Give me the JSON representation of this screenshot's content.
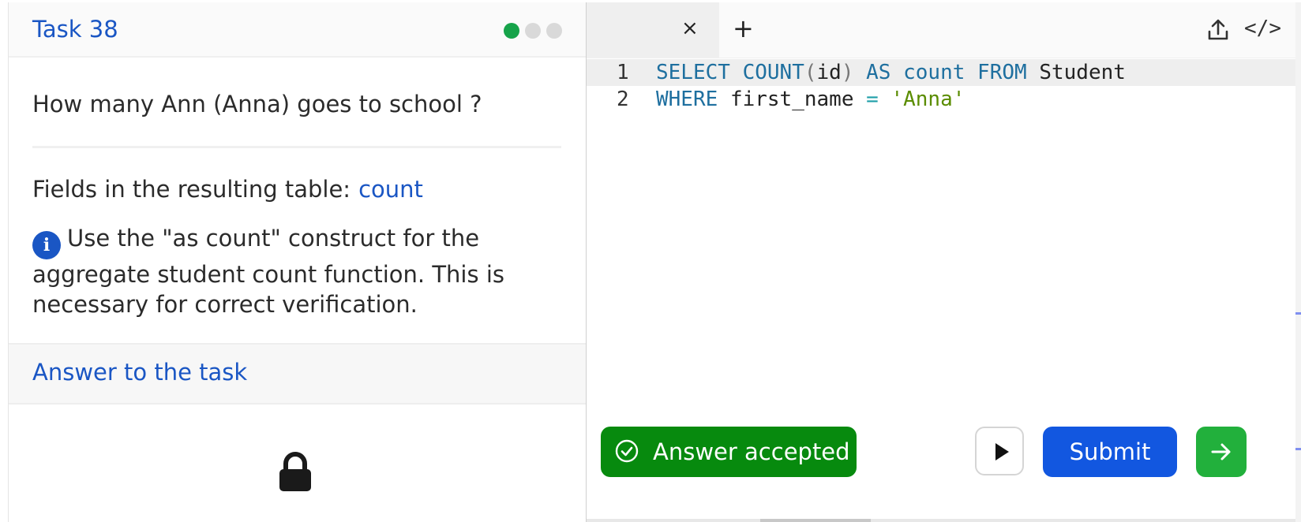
{
  "task": {
    "title": "Task 38",
    "question": "How many Ann (Anna) goes to school ?",
    "fields_label": "Fields in the resulting table:",
    "fields_value": "count",
    "hint": "Use the \"as count\" construct for the aggregate student count function. This is necessary for correct verification.",
    "answer_link": "Answer to the task"
  },
  "progress_dots": [
    {
      "state": "done",
      "color": "#16a34a"
    },
    {
      "state": "pending",
      "color": "#d9d9d9"
    },
    {
      "state": "pending",
      "color": "#d9d9d9"
    }
  ],
  "editor": {
    "tab_close": "×",
    "tab_add": "+",
    "upload_icon": "upload-icon",
    "code_icon_glyph": "</>",
    "lines": [
      {
        "number": "1",
        "tokens": [
          "SELECT",
          "COUNT",
          "(",
          "id",
          ")",
          "AS",
          "count",
          "FROM",
          "Student"
        ]
      },
      {
        "number": "2",
        "tokens": [
          "WHERE",
          "first_name",
          "=",
          "'Anna'"
        ]
      }
    ]
  },
  "actions": {
    "status": "Answer accepted",
    "status_color": "#078a0e",
    "submit": "Submit",
    "submit_color": "#1257e0",
    "next_color": "#22b03c"
  }
}
